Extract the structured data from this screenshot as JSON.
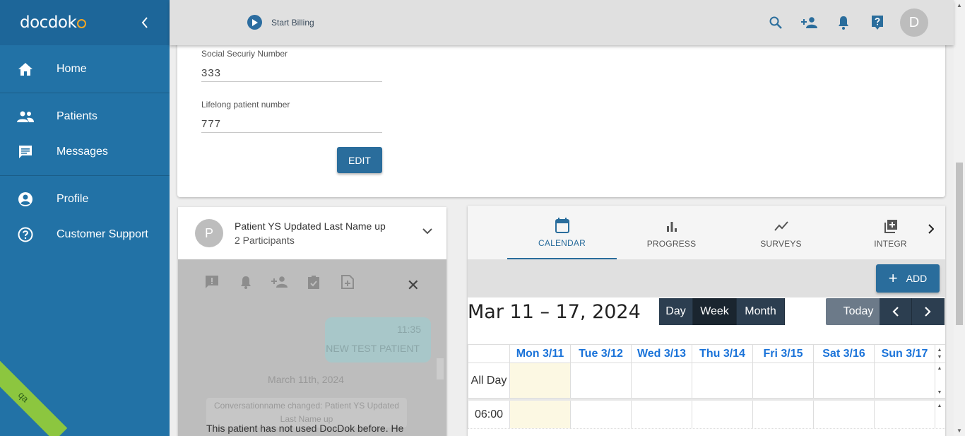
{
  "sidebar": {
    "logo": "docdok",
    "items": [
      {
        "label": "Home",
        "icon": "home-icon"
      },
      {
        "label": "Patients",
        "icon": "people-icon"
      },
      {
        "label": "Messages",
        "icon": "message-icon"
      },
      {
        "label": "Profile",
        "icon": "account-circle-icon"
      },
      {
        "label": "Customer Support",
        "icon": "help-circle-icon"
      }
    ],
    "env_badge": "qa"
  },
  "topbar": {
    "billing_label": "Start Billing",
    "avatar_letter": "D"
  },
  "patient_form": {
    "ssn_label": "Social Securiy Number",
    "ssn_value": "333",
    "lifelong_label": "Lifelong patient number",
    "lifelong_value": "777",
    "edit_label": "EDIT"
  },
  "chat": {
    "avatar_letter": "P",
    "title": "Patient YS Updated Last Name up",
    "participants": "2 Participants",
    "bubble_time": "11:35",
    "bubble_text": "NEW TEST PATIENT",
    "date": "March 11th, 2024",
    "note": "Conversationname changed: Patient YS Updated Last Name up",
    "message": "This patient has not used DocDok before. He"
  },
  "tabs": [
    {
      "label": "CALENDAR",
      "active": true
    },
    {
      "label": "PROGRESS",
      "active": false
    },
    {
      "label": "SURVEYS",
      "active": false
    },
    {
      "label": "INTEGR",
      "active": false
    }
  ],
  "calendar": {
    "add_label": "ADD",
    "range": "Mar 11 – 17, 2024",
    "views": [
      "Day",
      "Week",
      "Month"
    ],
    "active_view": "Week",
    "today_label": "Today",
    "days": [
      "Mon 3/11",
      "Tue 3/12",
      "Wed 3/13",
      "Thu 3/14",
      "Fri 3/15",
      "Sat 3/16",
      "Sun 3/17"
    ],
    "all_day_label": "All Day",
    "first_time": "06:00"
  },
  "colors": {
    "sidebar": "#2272a6",
    "primary": "#2a6d9c",
    "header_link": "#1a73d9",
    "today_highlight": "#fcf8e3",
    "qa_badge": "#8cc63f"
  }
}
